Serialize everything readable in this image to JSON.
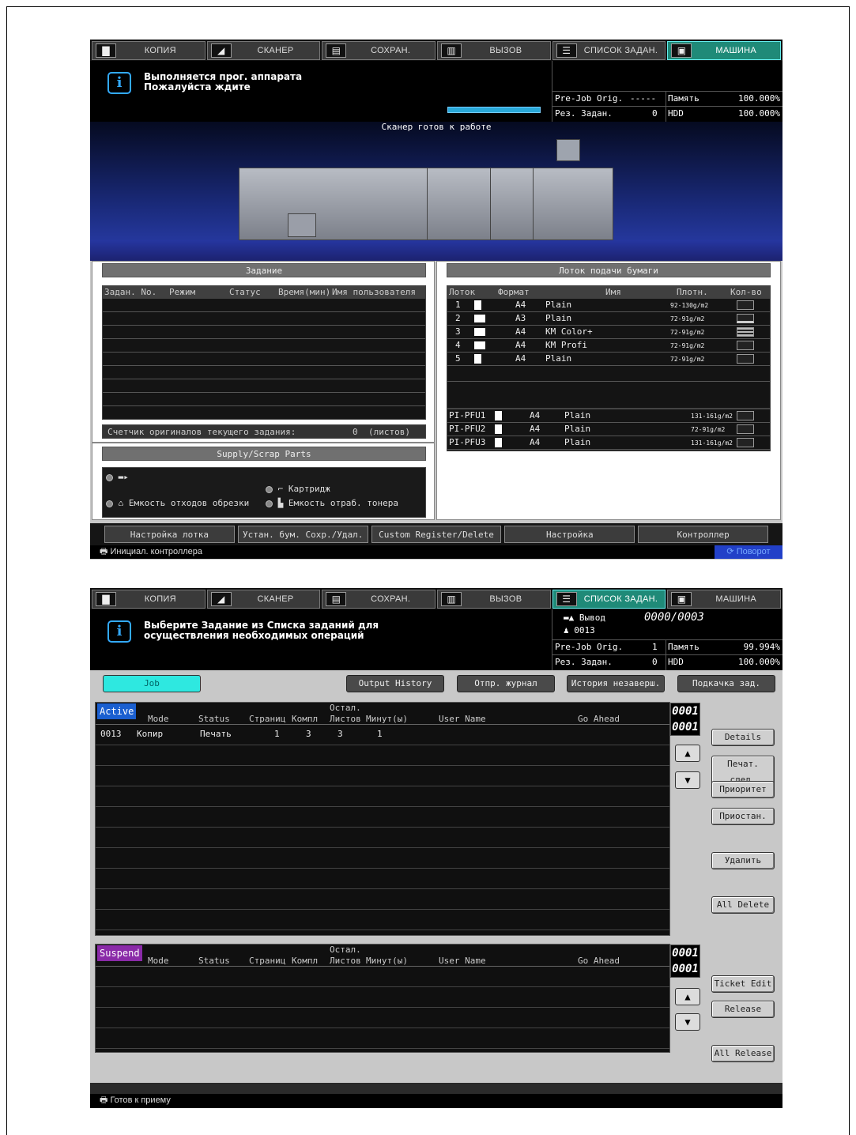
{
  "tabs": [
    {
      "label": "КОПИЯ",
      "icon": "copy-icon"
    },
    {
      "label": "СКАНЕР",
      "icon": "scanner-icon"
    },
    {
      "label": "СОХРАН.",
      "icon": "store-icon"
    },
    {
      "label": "ВЫЗОВ",
      "icon": "recall-icon"
    },
    {
      "label": "СПИСОК ЗАДАН.",
      "icon": "job-list-icon"
    },
    {
      "label": "МАШИНА",
      "icon": "machine-icon"
    }
  ],
  "screen1": {
    "message_line1": "Выполняется прог. аппарата",
    "message_line2": "Пожалуйста ждите",
    "prejob_label": "Pre-Job Orig.",
    "prejob_value": "-----",
    "res_label": "Рез. Задан.",
    "res_value": "0",
    "mem_label": "Память",
    "mem_value": "100.000%",
    "hdd_label": "HDD",
    "hdd_value": "100.000%",
    "scanner_ready": "Сканер готов к работе",
    "job_panel": {
      "title": "Задание",
      "headers": [
        "Задан. No.",
        "Режим",
        "Статус",
        "Время(мин)",
        "Имя пользователя"
      ],
      "counter_label": "Счетчик оригиналов текущего задания:",
      "counter_value": "0",
      "counter_unit": "(листов)"
    },
    "tray_panel": {
      "title": "Лоток подачи бумаги",
      "headers": [
        "Лоток",
        "Формат",
        "Имя",
        "Плотн.",
        "Кол-во"
      ],
      "rows": [
        {
          "tray": "1",
          "size": "A4",
          "name": "Plain",
          "weight": "92-130g/m2",
          "level": 0
        },
        {
          "tray": "2",
          "size": "A3",
          "name": "Plain",
          "weight": "72-91g/m2",
          "level": 0.2
        },
        {
          "tray": "3",
          "size": "A4",
          "name": "KM Color+",
          "weight": "72-91g/m2",
          "level": 1
        },
        {
          "tray": "4",
          "size": "A4",
          "name": "KM Profi",
          "weight": "72-91g/m2",
          "level": 0
        },
        {
          "tray": "5",
          "size": "A4",
          "name": "Plain",
          "weight": "72-91g/m2",
          "level": 0
        }
      ],
      "pfu_rows": [
        {
          "tray": "PI-PFU1",
          "size": "A4",
          "name": "Plain",
          "weight": "131-161g/m2"
        },
        {
          "tray": "PI-PFU2",
          "size": "A4",
          "name": "Plain",
          "weight": "72-91g/m2"
        },
        {
          "tray": "PI-PFU3",
          "size": "A4",
          "name": "Plain",
          "weight": "131-161g/m2"
        }
      ]
    },
    "supply": {
      "title": "Supply/Scrap Parts",
      "cartridge": "Картридж",
      "trim_bin": "Емкость отходов обрезки",
      "toner_bin": "Емкость отраб. тонера"
    },
    "buttons": [
      "Настройка лотка",
      "Устан. бум. Сохр./Удал.",
      "Custom Register/Delete",
      "Настройка",
      "Контроллер"
    ],
    "status_text": "Инициал. контроллера",
    "rotate": "Поворот"
  },
  "screen2": {
    "message_line1": "Выберите Задание из Списка заданий для",
    "message_line2": "осуществления необходимых операций",
    "output_label": "Вывод",
    "output_counter": "0000/0003",
    "job_no": "0013",
    "prejob_label": "Pre-Job Orig.",
    "prejob_value": "1",
    "res_label": "Рез. Задан.",
    "res_value": "0",
    "mem_label": "Память",
    "mem_value": "99.994%",
    "hdd_label": "HDD",
    "hdd_value": "100.000%",
    "top_buttons": [
      "Job",
      "Output History",
      "Отпр. журнал",
      "История незаверш.",
      "Подкачка зад."
    ],
    "active_label": "Active",
    "suspend_label": "Suspend",
    "headers": [
      "Mode",
      "Status",
      "Страниц",
      "Компл",
      "Остал.",
      "Листов",
      "Минут(ы)",
      "User Name",
      "Go Ahead"
    ],
    "active_rows": [
      {
        "no": "0013",
        "mode": "Копир",
        "status": "Печать",
        "pages": "1",
        "sets": "3",
        "sheets": "3",
        "minutes": "1",
        "user": "",
        "ahead": ""
      }
    ],
    "active_counter_top": "0001",
    "active_counter_bottom": "0001",
    "suspend_counter_top": "0001",
    "suspend_counter_bottom": "0001",
    "side_buttons": [
      "Details",
      "Печат. след.",
      "Приоритет",
      "Приостан.",
      "Удалить",
      "All Delete"
    ],
    "suspend_buttons": [
      "Ticket Edit",
      "Release",
      "All Release"
    ],
    "status_text": "Готов к приему"
  }
}
